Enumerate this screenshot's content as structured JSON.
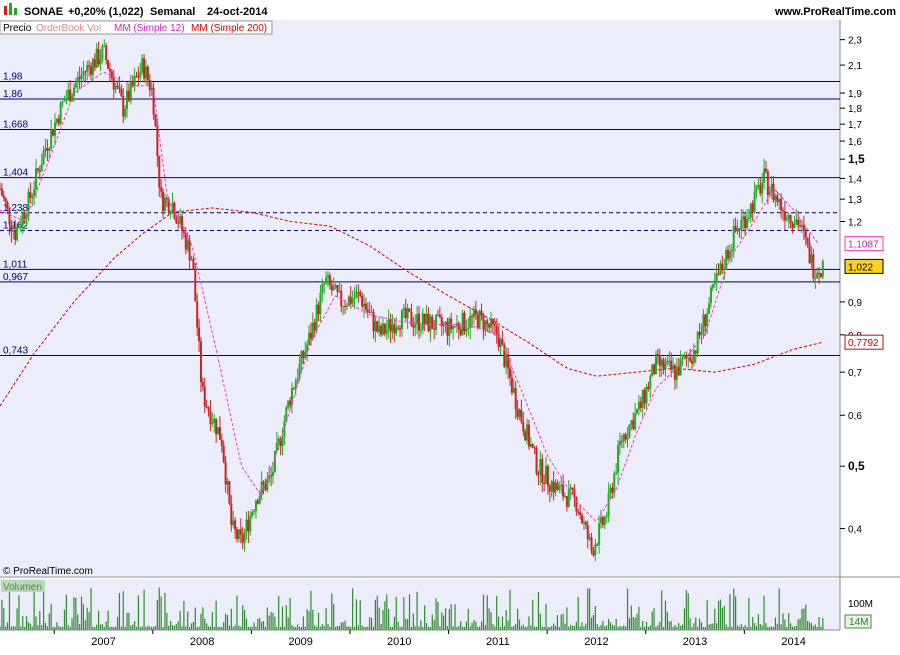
{
  "header": {
    "symbol": "SONAE",
    "change": "+0,20% (1,022)",
    "period": "Semanal",
    "date": "24-oct-2014",
    "site": "www.ProRealTime.com"
  },
  "legend": {
    "price": "Precio",
    "orderbook": "OrderBook Vol",
    "ma12": "MM (Simple 12)",
    "ma200": "MM (Simple 200)"
  },
  "watermark": "© ProRealTime.com",
  "volume_panel": {
    "label": "Volumen",
    "tick_100m": "100M",
    "last_badge": "14M"
  },
  "colors": {
    "background": "#ecedfb",
    "up": "#22aa22",
    "down": "#cc2222",
    "ma12": "#ff33cc",
    "ma200": "#dd0000",
    "level_line": "#000080",
    "volume": "#2e8b2e"
  },
  "chart_data": {
    "type": "candlestick",
    "scale": "log",
    "y_range": [
      0.34,
      2.45
    ],
    "x_range": [
      2006.45,
      2014.95
    ],
    "x_ticks": [
      "2007",
      "2008",
      "2009",
      "2010",
      "2011",
      "2012",
      "2013",
      "2014"
    ],
    "y_ticks": [
      "2,3",
      "2,1",
      "1,9",
      "1,8",
      "1,7",
      "1,6",
      "1,5",
      "1,4",
      "1,3",
      "1,2",
      "0,9",
      "0,8",
      "0,7",
      "0,6",
      "0,5",
      "0,4"
    ],
    "horizontal_levels": [
      {
        "label": "1,98",
        "value": 1.98,
        "style": "solid"
      },
      {
        "label": "1,86",
        "value": 1.86,
        "style": "solid"
      },
      {
        "label": "1,668",
        "value": 1.668,
        "style": "solid"
      },
      {
        "label": "1,404",
        "value": 1.404,
        "style": "solid"
      },
      {
        "label": "1,238",
        "value": 1.238,
        "style": "dashed"
      },
      {
        "label": "1,162",
        "value": 1.162,
        "style": "dashed"
      },
      {
        "label": "1,011",
        "value": 1.011,
        "style": "solid"
      },
      {
        "label": "0,967",
        "value": 0.967,
        "style": "solid"
      },
      {
        "label": "0,743",
        "value": 0.743,
        "style": "solid"
      }
    ],
    "price_tags": [
      {
        "label": "1,1087",
        "value": 1.1087,
        "series": "MM (Simple 12)"
      },
      {
        "label": "1,022",
        "value": 1.022,
        "series": "Precio"
      },
      {
        "label": "0,7792",
        "value": 0.7792,
        "series": "MM (Simple 200)"
      }
    ],
    "price_path": [
      [
        2006.45,
        1.35
      ],
      [
        2006.6,
        1.15
      ],
      [
        2006.75,
        1.3
      ],
      [
        2006.9,
        1.55
      ],
      [
        2007.1,
        1.85
      ],
      [
        2007.3,
        2.05
      ],
      [
        2007.5,
        2.2
      ],
      [
        2007.7,
        1.8
      ],
      [
        2007.9,
        2.1
      ],
      [
        2008.0,
        1.9
      ],
      [
        2008.08,
        1.3
      ],
      [
        2008.2,
        1.28
      ],
      [
        2008.4,
        1.05
      ],
      [
        2008.5,
        0.65
      ],
      [
        2008.7,
        0.55
      ],
      [
        2008.8,
        0.4
      ],
      [
        2008.9,
        0.38
      ],
      [
        2009.05,
        0.45
      ],
      [
        2009.2,
        0.48
      ],
      [
        2009.4,
        0.65
      ],
      [
        2009.6,
        0.8
      ],
      [
        2009.75,
        0.97
      ],
      [
        2009.9,
        0.9
      ],
      [
        2010.1,
        0.92
      ],
      [
        2010.3,
        0.8
      ],
      [
        2010.5,
        0.85
      ],
      [
        2010.7,
        0.84
      ],
      [
        2011.0,
        0.82
      ],
      [
        2011.3,
        0.85
      ],
      [
        2011.5,
        0.8
      ],
      [
        2011.7,
        0.62
      ],
      [
        2011.9,
        0.5
      ],
      [
        2012.1,
        0.46
      ],
      [
        2012.3,
        0.44
      ],
      [
        2012.45,
        0.37
      ],
      [
        2012.6,
        0.42
      ],
      [
        2012.75,
        0.55
      ],
      [
        2012.95,
        0.62
      ],
      [
        2013.1,
        0.72
      ],
      [
        2013.3,
        0.7
      ],
      [
        2013.5,
        0.76
      ],
      [
        2013.7,
        0.95
      ],
      [
        2013.9,
        1.15
      ],
      [
        2014.05,
        1.25
      ],
      [
        2014.2,
        1.4
      ],
      [
        2014.4,
        1.25
      ],
      [
        2014.55,
        1.2
      ],
      [
        2014.7,
        1.02
      ],
      [
        2014.8,
        1.022
      ]
    ],
    "ma12_path": [
      [
        2006.45,
        1.25
      ],
      [
        2006.7,
        1.2
      ],
      [
        2006.95,
        1.5
      ],
      [
        2007.2,
        1.9
      ],
      [
        2007.5,
        2.05
      ],
      [
        2007.8,
        1.95
      ],
      [
        2008.0,
        1.95
      ],
      [
        2008.15,
        1.3
      ],
      [
        2008.4,
        1.1
      ],
      [
        2008.65,
        0.75
      ],
      [
        2008.9,
        0.5
      ],
      [
        2009.1,
        0.45
      ],
      [
        2009.3,
        0.55
      ],
      [
        2009.6,
        0.78
      ],
      [
        2009.85,
        0.92
      ],
      [
        2010.2,
        0.86
      ],
      [
        2010.5,
        0.84
      ],
      [
        2010.8,
        0.83
      ],
      [
        2011.2,
        0.83
      ],
      [
        2011.5,
        0.8
      ],
      [
        2011.75,
        0.65
      ],
      [
        2012.0,
        0.52
      ],
      [
        2012.3,
        0.44
      ],
      [
        2012.5,
        0.41
      ],
      [
        2012.7,
        0.46
      ],
      [
        2012.9,
        0.56
      ],
      [
        2013.1,
        0.66
      ],
      [
        2013.35,
        0.72
      ],
      [
        2013.6,
        0.8
      ],
      [
        2013.85,
        1.05
      ],
      [
        2014.1,
        1.2
      ],
      [
        2014.3,
        1.35
      ],
      [
        2014.5,
        1.25
      ],
      [
        2014.75,
        1.1087
      ]
    ],
    "ma200_path": [
      [
        2006.45,
        0.62
      ],
      [
        2006.8,
        0.75
      ],
      [
        2007.2,
        0.9
      ],
      [
        2007.6,
        1.05
      ],
      [
        2007.9,
        1.15
      ],
      [
        2008.2,
        1.24
      ],
      [
        2008.6,
        1.26
      ],
      [
        2009.0,
        1.24
      ],
      [
        2009.4,
        1.2
      ],
      [
        2009.8,
        1.18
      ],
      [
        2010.2,
        1.1
      ],
      [
        2010.6,
        1.0
      ],
      [
        2011.0,
        0.92
      ],
      [
        2011.4,
        0.85
      ],
      [
        2011.8,
        0.78
      ],
      [
        2012.2,
        0.71
      ],
      [
        2012.5,
        0.69
      ],
      [
        2012.9,
        0.7
      ],
      [
        2013.3,
        0.71
      ],
      [
        2013.7,
        0.7
      ],
      [
        2014.1,
        0.72
      ],
      [
        2014.5,
        0.76
      ],
      [
        2014.8,
        0.7792
      ]
    ]
  }
}
